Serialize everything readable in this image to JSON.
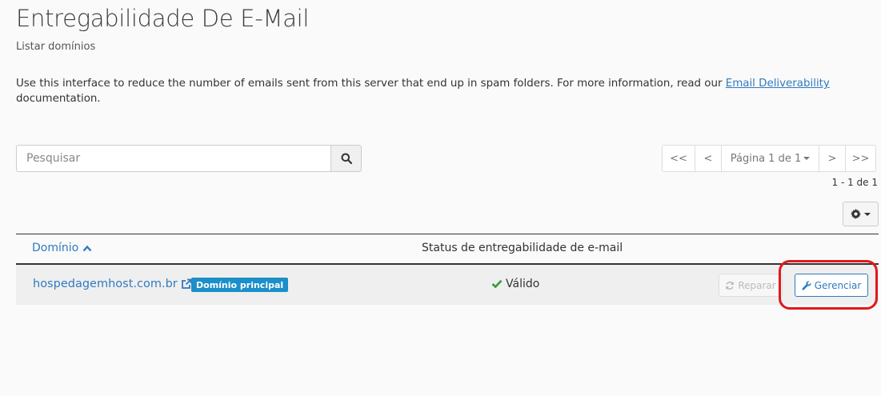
{
  "page": {
    "title": "Entregabilidade De E-Mail",
    "subtitle": "Listar domínios",
    "intro_text": "Use this interface to reduce the number of emails sent from this server that end up in spam folders. For more information, read our ",
    "intro_link": "Email Deliverability",
    "intro_suffix": " documentation."
  },
  "search": {
    "placeholder": "Pesquisar",
    "icon": "search-icon"
  },
  "pagination": {
    "first": "<<",
    "prev": "<",
    "page_label": "Página 1 de 1",
    "next": ">",
    "last": ">>",
    "count_text": "1 - 1 de 1"
  },
  "settings": {
    "icon": "gear-icon"
  },
  "table": {
    "col_domain": "Domínio",
    "col_status": "Status de entregabilidade de e-mail",
    "rows": [
      {
        "domain": "hospedagemhost.com.br",
        "badge": "Domínio principal",
        "status": "Válido",
        "repair_label": "Reparar",
        "manage_label": "Gerenciar"
      }
    ]
  },
  "colors": {
    "link": "#2f7bbf",
    "badge": "#1c8fc9",
    "valid": "#3a9a3a",
    "highlight": "#e0191b"
  }
}
